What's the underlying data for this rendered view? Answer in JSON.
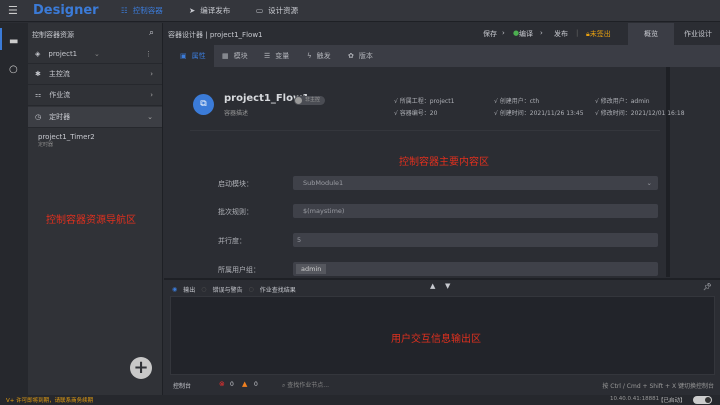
{
  "app": {
    "title": "Designer",
    "nav": [
      {
        "label": "控制容器",
        "icon": "list-icon",
        "active": true
      },
      {
        "label": "编译发布",
        "icon": "send-icon"
      },
      {
        "label": "设计资源",
        "icon": "inbox-icon"
      }
    ]
  },
  "sidebar": {
    "title": "控制容器资源",
    "project": "project1",
    "items": [
      {
        "label": "主控流"
      },
      {
        "label": "作业流"
      },
      {
        "label": "定时器"
      }
    ],
    "child": {
      "name": "project1_Timer2",
      "type": "定时器"
    },
    "annotation": "控制容器资源导航区"
  },
  "tabbar": {
    "breadcrumb_root": "容器设计器",
    "breadcrumb_item": "project1_Flow1",
    "save": "保存",
    "compile": "编译",
    "publish": "发布",
    "checkout": "未签出",
    "tabs": [
      "概览",
      "作业设计"
    ]
  },
  "subtabs": [
    "属性",
    "模块",
    "变量",
    "触发",
    "版本"
  ],
  "overview": {
    "name": "project1_Flow1",
    "toggle_label": "非主控",
    "desc": "容器描述",
    "meta": [
      {
        "label": "所属工程：",
        "value": "project1"
      },
      {
        "label": "创建用户：",
        "value": "cth"
      },
      {
        "label": "修改用户：",
        "value": "admin"
      },
      {
        "label": "容器编号：",
        "value": "20"
      },
      {
        "label": "创建时间：",
        "value": "2021/11/26 13:45"
      },
      {
        "label": "修改时间：",
        "value": "2021/12/01 16:18"
      }
    ],
    "annotation": "控制容器主要内容区"
  },
  "form": {
    "start_label": "启动模块：",
    "start_value": "SubModule1",
    "batch_label": "批次规则：",
    "batch_value": "$(maystime)",
    "parallel_label": "并行度：",
    "parallel_value": "5",
    "group_label": "所属用户组：",
    "group_value": "admin"
  },
  "output": {
    "tabs": [
      "输出",
      "错误与警告",
      "作业查找结果"
    ],
    "annotation": "用户交互信息输出区",
    "console": "控制台",
    "errors": "0",
    "warnings": "0",
    "search_placeholder": "查找作业节点...",
    "hint": "按 Ctrl / Cmd + Shift + X 键切换控制台"
  },
  "footer": {
    "warning": "V+ 许可即将到期，请联系商务续期",
    "server": "10.40.0.41:18881",
    "status": "【已启动】"
  },
  "colors": {
    "accent": "#3b7bd8",
    "annotation": "#e0301e",
    "warning": "#e8a010"
  }
}
